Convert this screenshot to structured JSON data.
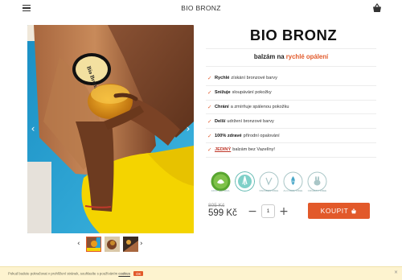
{
  "header": {
    "brand": "BIO BRONZ",
    "menu_icon": "hamburger-menu-icon",
    "cart_icon": "shopping-basket-icon"
  },
  "gallery": {
    "prev_arrow": "‹",
    "next_arrow": "›",
    "image_label": "Bio Bronz",
    "thumbs_prev": "‹",
    "thumbs_next": "›"
  },
  "product": {
    "title": "BIO BRONZ",
    "subtitle_part1": "balzám na ",
    "subtitle_accent": "rychlé opálení",
    "features": [
      {
        "bold": "Rychlé",
        "text": "získání bronzové barvy"
      },
      {
        "bold": "Snižuje",
        "text": "sloupávání pokožky"
      },
      {
        "bold": "Chrání",
        "text": "a zmírňuje spálenou pokožku"
      },
      {
        "bold": "Delší",
        "text": "udržení bronzové barvy"
      },
      {
        "bold": "100% zdravé",
        "text": "přírodní opalování"
      },
      {
        "bold": "JEDINÝ",
        "text": "balzám bez Vazelíny!"
      }
    ],
    "badges": [
      {
        "label": "100% NATURAL"
      },
      {
        "label": ""
      },
      {
        "label": "PARABEN FREE"
      },
      {
        "label": "ALCOHOL FREE"
      },
      {
        "label": "CRUELTY FREE"
      }
    ],
    "old_price": "805 Kč",
    "price": "599 Kč",
    "qty_minus": "−",
    "qty_plus": "+",
    "quantity": "1",
    "buy_label": "KOUPIT"
  },
  "cookie": {
    "text": "Pokud budete pokračovat v prohlížení stránek, souhlasíte s používáním",
    "link": "cookies",
    "ok": "OK",
    "close": "×"
  },
  "colors": {
    "accent": "#e2592a",
    "cookie_bg": "#fdf3cf"
  }
}
